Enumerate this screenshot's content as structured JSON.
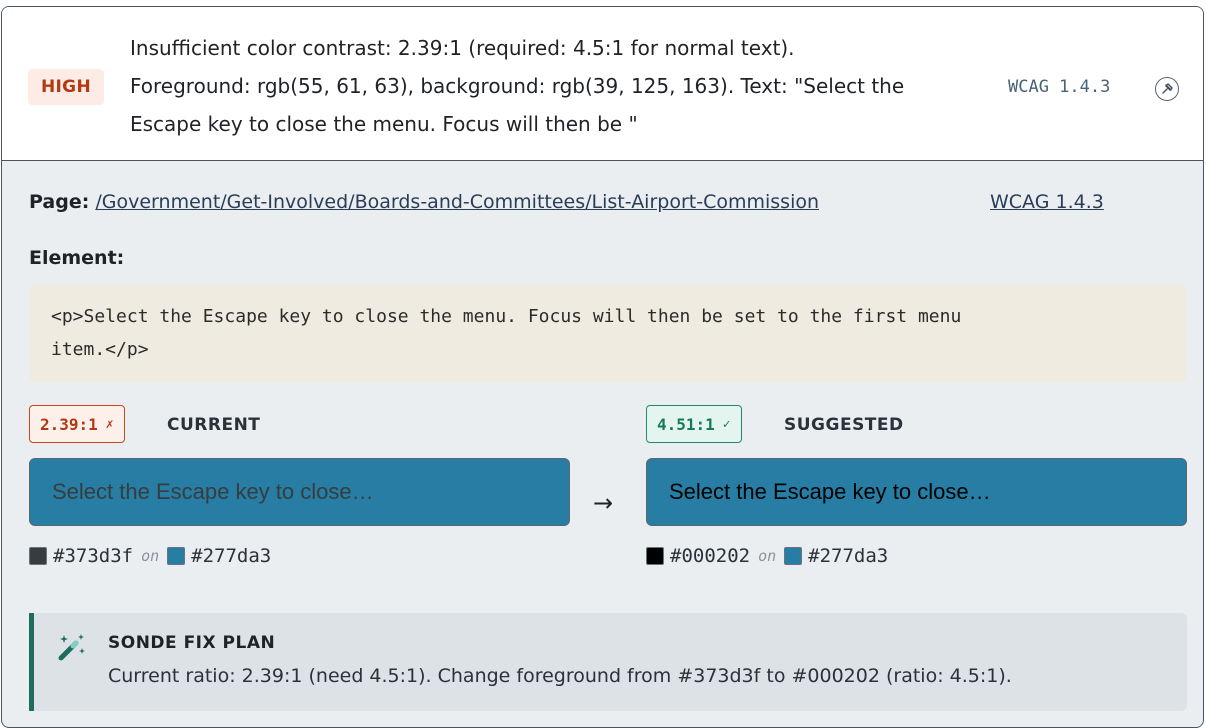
{
  "issue": {
    "severity": "HIGH",
    "summary_lines": [
      "Insufficient color contrast: 2.39:1 (required: 4.5:1 for normal text).",
      "Foreground: rgb(55, 61, 63), background: rgb(39, 125, 163). Text: \"Select the",
      "Escape key to close the menu. Focus will then be \""
    ],
    "criterion": "WCAG 1.4.3",
    "collapse_icon": "pin-icon"
  },
  "details": {
    "page_label": "Page:",
    "page_url": "/Government/Get-Involved/Boards-and-Committees/List-Airport-Commission",
    "wcag_link": "WCAG 1.4.3",
    "element_label": "Element:",
    "element_code_lines": [
      "<p>Select the Escape key to close the menu. Focus will then be set to the first menu",
      "item.</p>"
    ]
  },
  "current": {
    "ratio": "2.39:1",
    "mark": "✗",
    "label": "CURRENT",
    "preview_text": "Select the Escape key to close…",
    "foreground": "#373d3f",
    "background": "#277da3",
    "on_word": "on"
  },
  "suggested": {
    "ratio": "4.51:1",
    "mark": "✓",
    "label": "SUGGESTED",
    "preview_text": "Select the Escape key to close…",
    "foreground": "#000202",
    "background": "#277da3",
    "on_word": "on"
  },
  "arrow": "→",
  "fix_plan": {
    "title": "SONDE FIX PLAN",
    "icon": "magic-wand-icon",
    "text": "Current ratio: 2.39:1 (need 4.5:1). Change foreground from #373d3f to #000202 (ratio: 4.5:1)."
  },
  "colors": {
    "severity_high": "#b23a12",
    "ratio_bad": "#b23a12",
    "ratio_good": "#157a5b",
    "fix_accent": "#1f6b5e"
  }
}
